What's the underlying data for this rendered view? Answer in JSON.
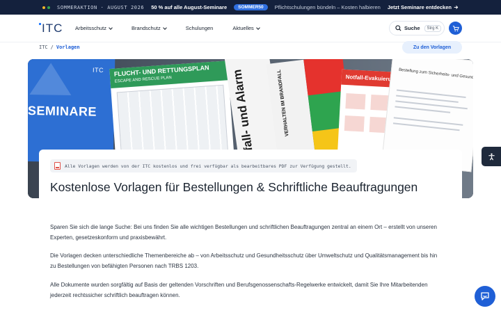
{
  "promo": {
    "label": "SOMMERAKTION · AUGUST 2026",
    "discount": "50 % auf alle August-Seminare",
    "code": "SOMMER50",
    "subtext": "Pflichtschulungen bündeln – Kosten halbieren",
    "cta": "Jetzt Seminare entdecken",
    "dot_colors": [
      "#f0b429",
      "#2fa54f"
    ]
  },
  "header": {
    "logo": "ITC",
    "nav": [
      {
        "label": "Arbeitsschutz",
        "has_dropdown": true
      },
      {
        "label": "Brandschutz",
        "has_dropdown": true
      },
      {
        "label": "Schulungen",
        "has_dropdown": false
      },
      {
        "label": "Aktuelles",
        "has_dropdown": true
      }
    ],
    "search_label": "Suche",
    "search_shortcut": "Strg K",
    "cart_icon": "cart-icon"
  },
  "breadcrumb": {
    "home": "ITC",
    "separator": "/",
    "current": "Vorlagen"
  },
  "to_templates_button": "Zu den Vorlagen",
  "hero": {
    "seminar_card_word": "SEMINARE",
    "seminar_card_brand": "ITC",
    "plan_title": "FLUCHT- UND RETTUNGSPLAN",
    "plan_subtitle": "ESCAPE AND RESCUE PLAN",
    "alarm_text": "Notfall- und Alarm",
    "steps_text": "VERHALTEN IM BRANDFALL",
    "evac_title": "Notfall-Evakuierung im Notfall",
    "doc_title": "Bestellung zum Sicherheits- und Gesundheitsschutzkoordinator (SiGeKo)",
    "brand_colors": [
      "#2d6fd3",
      "#2f9a59",
      "#e5322d",
      "#2ea44f",
      "#f5c518"
    ]
  },
  "content": {
    "notice": "Alle Vorlagen werden von der ITC kostenlos und frei verfügbar als bearbeitbares PDF zur Verfügung gestellt.",
    "title": "Kostenlose Vorlagen für Bestellungen & Schriftliche Beauftragungen",
    "paragraphs": [
      "Sparen Sie sich die lange Suche: Bei uns finden Sie alle wichtigen Bestellungen und schriftlichen Beauftragungen zentral an einem Ort – erstellt von unseren Experten, gesetzeskonform und praxisbewährt.",
      "Die Vorlagen decken unterschiedliche Themenbereiche ab – von Arbeitsschutz und Gesundheitsschutz über Umweltschutz und Qualitätsmanagement bis hin zu Bestellungen von befähigten Personen nach TRBS 1203.",
      "Alle Dokumente wurden sorgfältig auf Basis der geltenden Vorschriften und Berufsgenossenschafts-Regelwerke entwickelt, damit Sie Ihre Mitarbeitenden jederzeit rechtssicher schriftlich beauftragen können."
    ]
  },
  "floating": {
    "accessibility_icon": "accessibility-icon",
    "chat_icon": "chat-icon"
  }
}
